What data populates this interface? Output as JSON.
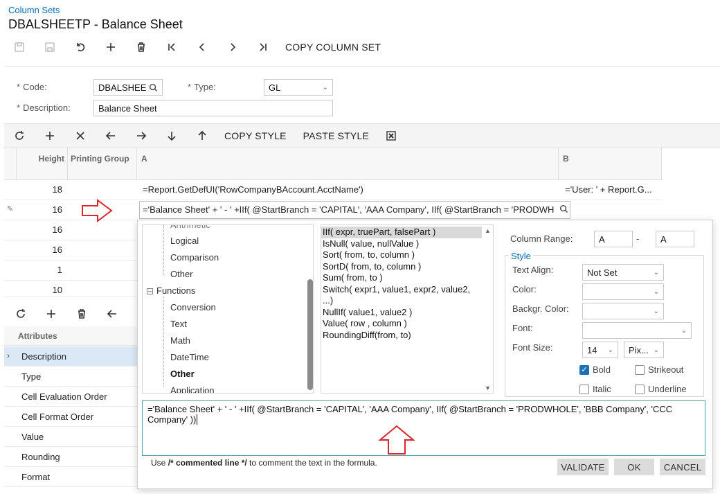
{
  "breadcrumb": "Column Sets",
  "title": "DBALSHEETP - Balance Sheet",
  "toolbar": {
    "copy_label": "COPY COLUMN SET"
  },
  "form": {
    "code_label": "Code:",
    "code_value": "DBALSHEE",
    "type_label": "Type:",
    "type_value": "GL",
    "desc_label": "Description:",
    "desc_value": "Balance Sheet"
  },
  "grid_toolbar": {
    "copy_style": "COPY STYLE",
    "paste_style": "PASTE STYLE"
  },
  "grid": {
    "headers": {
      "height": "Height",
      "printing": "Printing Group",
      "a": "A",
      "b": "B"
    },
    "rows": [
      {
        "height": "18",
        "a": "=Report.GetDefUI('RowCompanyBAccount.AcctName')",
        "b": "='User: ' + Report.G..."
      },
      {
        "height": "16",
        "a": "='Balance Sheet' + ' - ' +IIf( @StartBranch = 'CAPITAL', 'AAA Company',  IIf( @StartBranch = 'PRODWH",
        "b": ""
      },
      {
        "height": "16",
        "a": "",
        "b": ""
      },
      {
        "height": "16",
        "a": "",
        "b": ""
      },
      {
        "height": "1",
        "a": "",
        "b": ""
      },
      {
        "height": "10",
        "a": "",
        "b": ""
      }
    ]
  },
  "attributes": {
    "header": "Attributes",
    "items": [
      "Description",
      "Type",
      "Cell Evaluation Order",
      "Cell Format Order",
      "Value",
      "Rounding",
      "Format"
    ]
  },
  "dialog": {
    "tree": {
      "top_partial": "Arithmetic",
      "items_before": [
        "Logical",
        "Comparison",
        "Other"
      ],
      "functions_label": "Functions",
      "functions_children": [
        "Conversion",
        "Text",
        "Math",
        "DateTime",
        "Other",
        "Application"
      ]
    },
    "functions": [
      "IIf( expr, truePart, falsePart )",
      "IsNull( value, nullValue )",
      "Sort( from, to, column )",
      "SortD( from, to, column )",
      "Sum( from, to )",
      "Switch( expr1, value1, expr2, value2, ...)",
      "NullIf( value1, value2 )",
      "Value( row , column )",
      "RoundingDiff(from, to)"
    ],
    "column_range_label": "Column Range:",
    "range_from": "A",
    "range_to": "A",
    "range_dash": "-",
    "style_label": "Style",
    "text_align_label": "Text Align:",
    "text_align_value": "Not Set",
    "color_label": "Color:",
    "backgr_label": "Backgr. Color:",
    "font_label": "Font:",
    "font_size_label": "Font Size:",
    "font_size_value": "14",
    "font_unit_value": "Pix...",
    "bold_label": "Bold",
    "strikeout_label": "Strikeout",
    "italic_label": "Italic",
    "underline_label": "Underline",
    "formula": "='Balance Sheet' + ' - ' +IIf( @StartBranch = 'CAPITAL', 'AAA Company',  IIf( @StartBranch = 'PRODWHOLE', 'BBB Company', 'CCC Company' ))",
    "hint_prefix": "Use ",
    "hint_bold": "/* commented line */",
    "hint_suffix": " to comment the text in the formula.",
    "validate_label": "VALIDATE",
    "ok_label": "OK",
    "cancel_label": "CANCEL"
  },
  "colors": {
    "accent": "#0b6db7",
    "arrow": "#d9262a",
    "selected_row": "#dbe9f6"
  }
}
